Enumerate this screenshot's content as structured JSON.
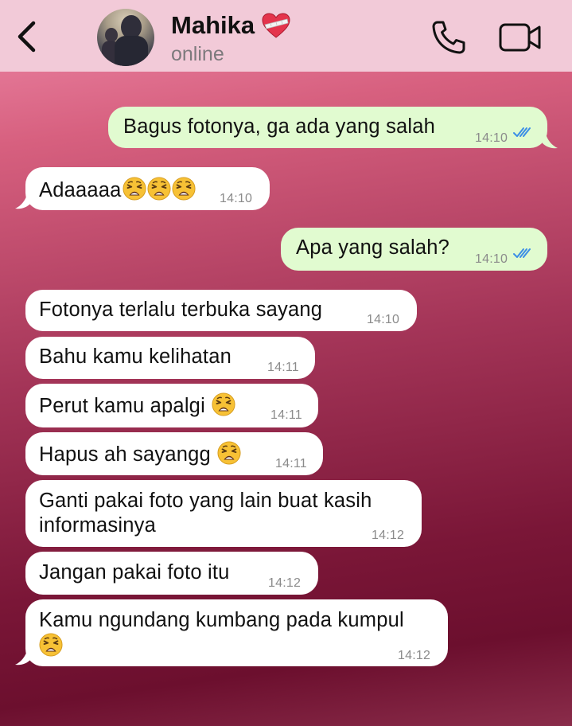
{
  "header": {
    "contact_name": "Mahika",
    "name_emoji_icon": "mending-heart-icon",
    "status": "online"
  },
  "messages": [
    {
      "dir": "out",
      "text": "Bagus fotonya, ga ada yang salah",
      "time": "14:10",
      "read": true
    },
    {
      "dir": "in",
      "text": "Adaaaaa",
      "emoji_count": 3,
      "time": "14:10"
    },
    {
      "dir": "out",
      "text": "Apa yang salah?",
      "time": "14:10",
      "read": true
    },
    {
      "dir": "in",
      "text": "Fotonya terlalu terbuka sayang",
      "time": "14:10"
    },
    {
      "dir": "in",
      "text": "Bahu kamu kelihatan",
      "time": "14:11"
    },
    {
      "dir": "in",
      "text": "Perut kamu apalgi",
      "emoji_count": 1,
      "time": "14:11"
    },
    {
      "dir": "in",
      "text": "Hapus ah sayangg",
      "emoji_count": 1,
      "time": "14:11"
    },
    {
      "dir": "in",
      "text_line1": "Ganti pakai foto yang lain buat kasih",
      "text_line2": "informasinya",
      "time": "14:12"
    },
    {
      "dir": "in",
      "text": "Jangan pakai foto itu",
      "time": "14:12"
    },
    {
      "dir": "in",
      "text": "Kamu ngundang kumbang pada kumpul",
      "emoji_count": 1,
      "time": "14:12"
    }
  ],
  "colors": {
    "header_bg": "#f2cad8",
    "outgoing_bubble": "#e1fbd0",
    "incoming_bubble": "#ffffff",
    "read_ticks": "#3b8ee6"
  }
}
